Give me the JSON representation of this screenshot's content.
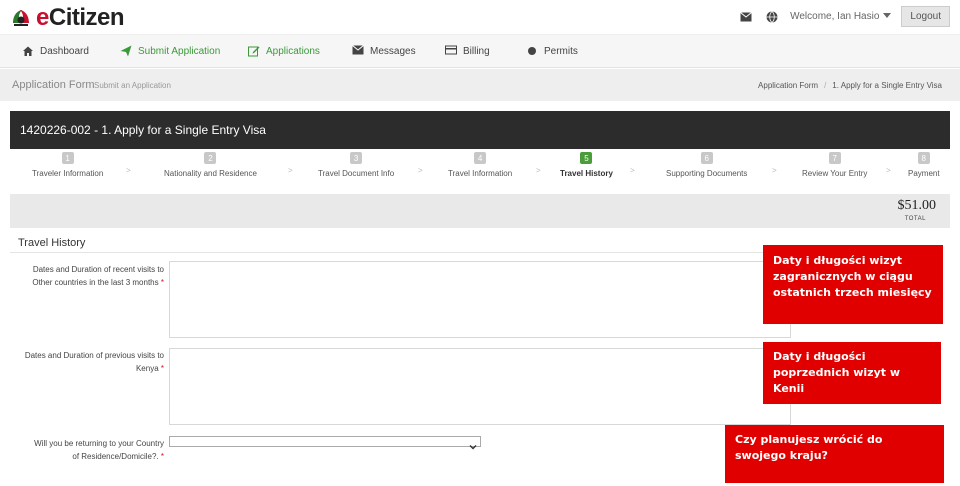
{
  "header": {
    "logo_prefix": "e",
    "logo_rest": "Citizen",
    "welcome": "Welcome, Ian Hasio",
    "logout_label": "Logout"
  },
  "nav": [
    {
      "label": "Dashboard",
      "icon": "home-icon"
    },
    {
      "label": "Submit Application",
      "icon": "paper-plane-icon"
    },
    {
      "label": "Applications",
      "icon": "edit-icon"
    },
    {
      "label": "Messages",
      "icon": "envelope-icon"
    },
    {
      "label": "Billing",
      "icon": "credit-card-icon"
    },
    {
      "label": "Permits",
      "icon": "circle-icon"
    }
  ],
  "breadcrumb": {
    "title": "Application Form",
    "subtitle": "Submit an Application",
    "right": [
      "Application Form",
      "1. Apply for a Single Entry Visa"
    ]
  },
  "form_title": "1420226-002 - 1. Apply for a Single Entry Visa",
  "steps": [
    {
      "num": "1",
      "label": "Traveler Information"
    },
    {
      "num": "2",
      "label": "Nationality and Residence"
    },
    {
      "num": "3",
      "label": "Travel Document Info"
    },
    {
      "num": "4",
      "label": "Travel Information"
    },
    {
      "num": "5",
      "label": "Travel History",
      "active": true
    },
    {
      "num": "6",
      "label": "Supporting Documents"
    },
    {
      "num": "7",
      "label": "Review Your Entry"
    },
    {
      "num": "8",
      "label": "Payment"
    }
  ],
  "total": {
    "amount": "$51.00",
    "label": "TOTAL"
  },
  "section": {
    "title": "Travel History",
    "fields": [
      {
        "label_line1": "Dates and Duration of recent visits to",
        "label_line2": "Other countries in the last 3 months",
        "value": ""
      },
      {
        "label_line1": "Dates and Duration of previous visits to",
        "label_line2": "Kenya",
        "value": ""
      },
      {
        "label_line1": "Will you be returning to your Country",
        "label_line2": "of Residence/Domicile?.",
        "selected": ""
      }
    ]
  },
  "callouts": [
    "Daty i długości wizyt zagranicznych w ciągu ostatnich trzech miesięcy",
    "Daty i długości poprzednich wizyt w Kenii",
    "Czy planujesz wrócić do swojego kraju?"
  ],
  "colors": {
    "brand_red": "#c8102e",
    "active_step": "#4a9d3a",
    "nav_green": "#3a9a3a",
    "callout_red": "#e00000",
    "title_bar": "#2c2c2c"
  }
}
